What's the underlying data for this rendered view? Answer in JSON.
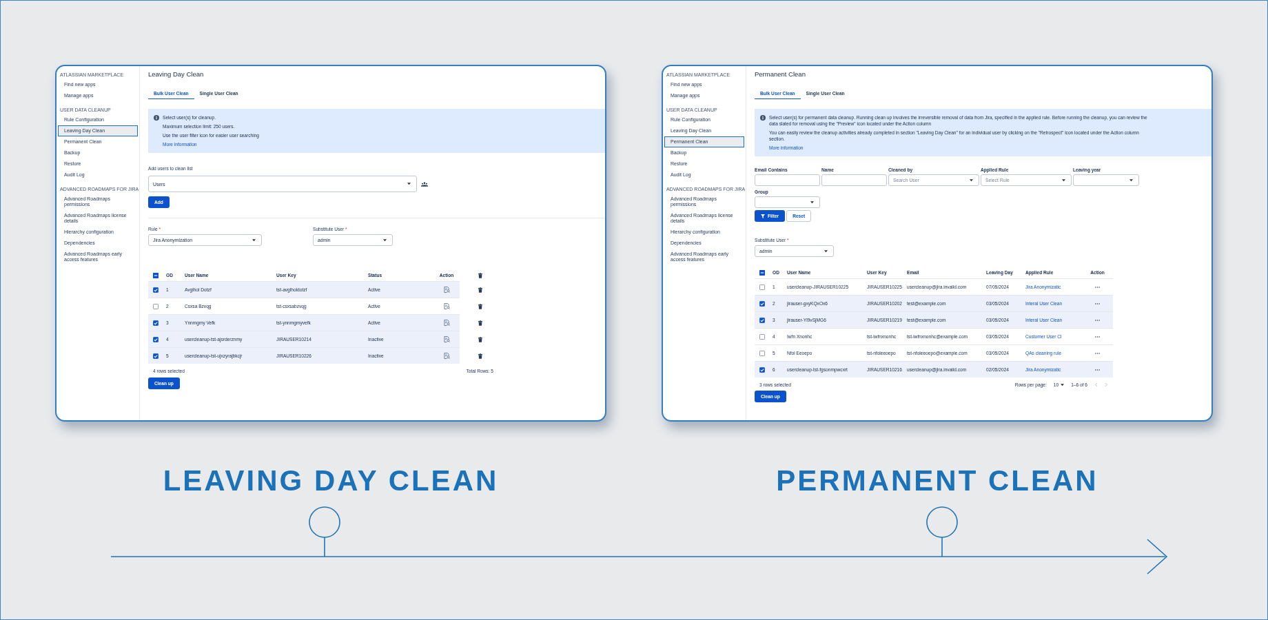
{
  "panels": [
    {
      "kind": "leaving_day",
      "sidebar": [
        {
          "heading": "ATLASSIAN MARKETPLACE",
          "items": [
            {
              "label": "Find new apps",
              "selected": false
            },
            {
              "label": "Manage apps",
              "selected": false
            }
          ]
        },
        {
          "heading": "USER DATA CLEANUP",
          "items": [
            {
              "label": "Rule Configuration",
              "selected": false
            },
            {
              "label": "Leaving Day Clean",
              "selected": true
            },
            {
              "label": "Permanent Clean",
              "selected": false
            },
            {
              "label": "Backup",
              "selected": false
            },
            {
              "label": "Restore",
              "selected": false
            },
            {
              "label": "Audit Log",
              "selected": false
            }
          ]
        },
        {
          "heading": "ADVANCED ROADMAPS FOR JIRA",
          "items": [
            {
              "label": "Advanced Roadmaps permissions",
              "selected": false
            },
            {
              "label": "Advanced Roadmaps license details",
              "selected": false
            },
            {
              "label": "Hierarchy configuration",
              "selected": false
            },
            {
              "label": "Dependencies",
              "selected": false
            },
            {
              "label": "Advanced Roadmaps early access features",
              "selected": false
            }
          ]
        }
      ],
      "title": "Leaving Day Clean",
      "tabs": [
        {
          "label": "Bulk User Clean",
          "selected": true
        },
        {
          "label": "Single User Clean",
          "selected": false
        }
      ],
      "info": {
        "lines": [
          "Select user(s) for cleanup.",
          "Maximum selection limit: 250 users.",
          "Use the user filter icon for easier user searching"
        ],
        "link": "More information"
      },
      "add_users": {
        "label": "Add users to clean list",
        "value": "Users",
        "button": "Add"
      },
      "fields": [
        {
          "label": "Rule",
          "mark": "*",
          "value": "Jira Anonymization"
        },
        {
          "label": "Substitute User",
          "mark": "*",
          "value": "admin"
        }
      ],
      "table": {
        "header_checkbox": {
          "indeterminate": true
        },
        "columns": [
          "OD",
          "User Name",
          "User Key",
          "Status",
          "Action"
        ],
        "rows": [
          {
            "selected": true,
            "cells": [
              "1",
              "Avglhol Dotzf",
              "tst-avglholdotzf",
              "Active"
            ]
          },
          {
            "selected": false,
            "cells": [
              "2",
              "Csxsa Bzvqg",
              "tst-csxsabzvqg",
              "Active"
            ]
          },
          {
            "selected": true,
            "cells": [
              "3",
              "Ynnmgmy Vefk",
              "tst-ynnmgmyvefk",
              "Active"
            ]
          },
          {
            "selected": true,
            "cells": [
              "4",
              "usercleanup-tst-ajsrderznmy",
              "JIRAUSER10214",
              "Inactive"
            ]
          },
          {
            "selected": true,
            "cells": [
              "5",
              "usercleanup-tst-ujxzyrajbkcjr",
              "JIRAUSER10226",
              "Inactive"
            ]
          }
        ]
      },
      "footer": {
        "selected_count": "4 rows selected",
        "total": "Total Rows: 5"
      },
      "button": "Clean up"
    },
    {
      "kind": "permanent",
      "sidebar": [
        {
          "heading": "ATLASSIAN MARKETPLACE",
          "items": [
            {
              "label": "Find new apps",
              "selected": false
            },
            {
              "label": "Manage apps",
              "selected": false
            }
          ]
        },
        {
          "heading": "USER DATA CLEANUP",
          "items": [
            {
              "label": "Rule Configuration",
              "selected": false
            },
            {
              "label": "Leaving Day Clean",
              "selected": false
            },
            {
              "label": "Permanent Clean",
              "selected": true
            },
            {
              "label": "Backup",
              "selected": false
            },
            {
              "label": "Restore",
              "selected": false
            },
            {
              "label": "Audit Log",
              "selected": false
            }
          ]
        },
        {
          "heading": "ADVANCED ROADMAPS FOR JIRA",
          "items": [
            {
              "label": "Advanced Roadmaps permissions",
              "selected": false
            },
            {
              "label": "Advanced Roadmaps license details",
              "selected": false
            },
            {
              "label": "Hierarchy configuration",
              "selected": false
            },
            {
              "label": "Dependencies",
              "selected": false
            },
            {
              "label": "Advanced Roadmaps early access features",
              "selected": false
            }
          ]
        }
      ],
      "title": "Permanent Clean",
      "tabs": [
        {
          "label": "Bulk User Clean",
          "selected": true
        },
        {
          "label": "Single User Clean",
          "selected": false
        }
      ],
      "info": {
        "lines": [
          "Select user(s) for permanent data cleanup. Running clean up involves the irreversible removal of data from Jira, specified in the applied rule. Before running the cleanup, you can review the data slated for removal using the \"Preview\" icon located under the Action column",
          "You can easily review the cleanup activities already completed in section \"Leaving Day Clean\" for an individual user by clicking on the \"Retrospect\" icon located under the Action column section."
        ],
        "link": "More information"
      },
      "filters": [
        {
          "label": "Email Contains",
          "kind": "text"
        },
        {
          "label": "Name",
          "kind": "text"
        },
        {
          "label": "Cleaned by",
          "kind": "select",
          "placeholder": "Search User"
        },
        {
          "label": "Applied Rule",
          "kind": "select",
          "placeholder": "Select Rule"
        },
        {
          "label": "Leaving year",
          "kind": "select"
        },
        {
          "label": "Group",
          "kind": "select"
        }
      ],
      "filter_buttons": {
        "filter": "Filter",
        "reset": "Reset"
      },
      "fields": [
        {
          "label": "Substitute User",
          "mark": "*",
          "value": "admin"
        }
      ],
      "table": {
        "header_checkbox": {
          "indeterminate": true
        },
        "columns": [
          "OD",
          "User Name",
          "User Key",
          "Email",
          "Leaving Day",
          "Applied Rule",
          "Action"
        ],
        "rows": [
          {
            "selected": false,
            "cells": [
              "1",
              "usercleanup-JIRAUSER10225",
              "JIRAUSER10225",
              "usercleanup@jira.invalid.com",
              "07/05/2024",
              "Jira Anonymizatic"
            ]
          },
          {
            "selected": true,
            "cells": [
              "2",
              "jirauser-gxyKQxOx6",
              "JIRAUSER10202",
              "test@example.com",
              "03/05/2024",
              "Interal User Clean"
            ]
          },
          {
            "selected": true,
            "cells": [
              "3",
              "jirauser-Yl9vSjMG6",
              "JIRAUSER10219",
              "test@example.com",
              "03/05/2024",
              "Interal User Clean"
            ]
          },
          {
            "selected": false,
            "cells": [
              "4",
              "Iwfn Xnonhc",
              "tst-iwfnxnonhc",
              "tst-iwfnxnonhc@example.com",
              "03/05/2024",
              "Customer User Cl"
            ]
          },
          {
            "selected": false,
            "cells": [
              "5",
              "Nfol Eeoepo",
              "tst-nfoleeoepo",
              "tst-nfoleeoepo@example.com",
              "03/05/2024",
              "QAs cleaning rule"
            ]
          },
          {
            "selected": true,
            "cells": [
              "6",
              "usercleanup-tst-fgsonmpwcxrt",
              "JIRAUSER10216",
              "usercleanup@jira.invalid.com",
              "02/05/2024",
              "Jira Anonymizatic"
            ]
          }
        ]
      },
      "footer": {
        "selected_count": "3 rows selected",
        "rows_per_page_label": "Rows per page:",
        "rows_per_page": "10",
        "range": "1–6 of 6"
      },
      "button": "Clean up"
    }
  ],
  "captions": [
    "LEAVING DAY CLEAN",
    "PERMANENT CLEAN"
  ]
}
